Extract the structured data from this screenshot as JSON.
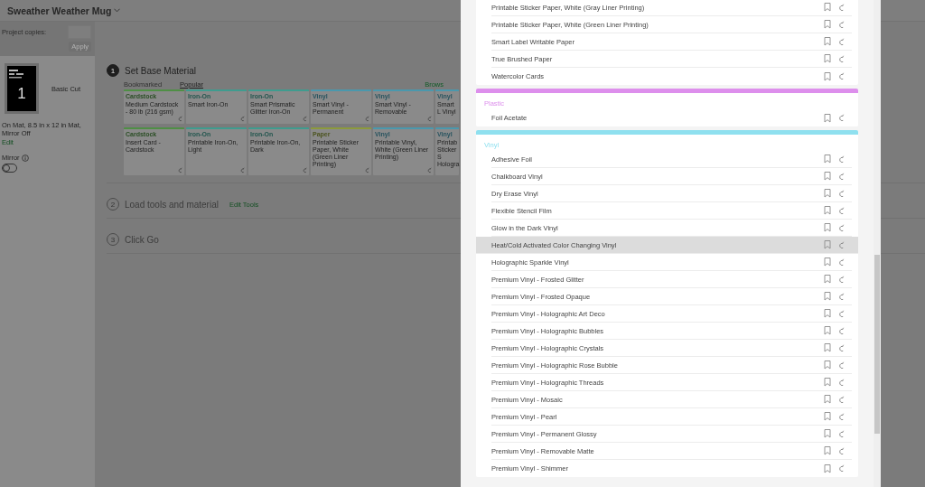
{
  "header": {
    "title": "Sweather Weather Mug"
  },
  "project_copies": {
    "label": "Project copies:",
    "apply": "Apply",
    "apply_disabled": true
  },
  "mat": {
    "number": "1",
    "name": "Basic Cut",
    "details": "On Mat, 8.5 in x 12 in Mat, Mirror Off",
    "edit": "Edit"
  },
  "mirror": {
    "label": "Mirror",
    "on": false
  },
  "steps": [
    {
      "number": "1",
      "title": "Set Base Material",
      "active": true
    },
    {
      "number": "2",
      "title": "Load tools and material",
      "link": "Edit Tools",
      "active": false
    },
    {
      "number": "3",
      "title": "Click Go",
      "active": false
    }
  ],
  "material_tabs": [
    {
      "label": "Bookmarked",
      "selected": false
    },
    {
      "label": "Popular",
      "selected": true
    }
  ],
  "browse_link": "Brows",
  "material_cards": [
    {
      "category": "Cardstock",
      "color": "#4f8f45",
      "name": "Medium Cardstock - 80 lb (216 gsm)"
    },
    {
      "category": "Iron-On",
      "color": "#3f9c8f",
      "name": "Smart Iron-On"
    },
    {
      "category": "Iron-On",
      "color": "#3f9c8f",
      "name": "Smart Prismatic Glitter Iron-On"
    },
    {
      "category": "Vinyl",
      "color": "#4a98ad",
      "name": "Smart Vinyl - Permanent"
    },
    {
      "category": "Vinyl",
      "color": "#4a98ad",
      "name": "Smart Vinyl - Removable"
    },
    {
      "category": "Vinyl",
      "color": "#4a98ad",
      "name": "Smart L Vinyl",
      "cut": true
    },
    {
      "category": "Cardstock",
      "color": "#4f8f45",
      "name": "Insert Card - Cardstock"
    },
    {
      "category": "Iron-On",
      "color": "#3f9c8f",
      "name": "Printable Iron-On, Light"
    },
    {
      "category": "Iron-On",
      "color": "#3f9c8f",
      "name": "Printable Iron-On, Dark"
    },
    {
      "category": "Paper",
      "color": "#8c9a3c",
      "name": "Printable Sticker Paper, White (Green Liner Printing)"
    },
    {
      "category": "Vinyl",
      "color": "#4a98ad",
      "name": "Printable Vinyl, White (Green Liner Printing)"
    },
    {
      "category": "Vinyl",
      "color": "#4a98ad",
      "name": "Printab Sticker S Hologra",
      "cut": true
    }
  ],
  "modal": {
    "sections": [
      {
        "items": [
          {
            "name": "Printable Sticker Paper, White (Gray Liner Printing)",
            "selected": false
          },
          {
            "name": "Printable Sticker Paper, White (Green Liner Printing)",
            "selected": false
          },
          {
            "name": "Smart Label Writable Paper",
            "selected": false
          },
          {
            "name": "True Brushed Paper",
            "selected": false
          },
          {
            "name": "Watercolor Cards",
            "selected": false
          }
        ]
      },
      {
        "name": "Plastic",
        "color": "#dd8fec",
        "items": [
          {
            "name": "Foil Acetate",
            "selected": false
          }
        ]
      },
      {
        "name": "Vinyl",
        "color": "#8fe0ef",
        "items": [
          {
            "name": "Adhesive Foil",
            "selected": false
          },
          {
            "name": "Chalkboard Vinyl",
            "selected": false
          },
          {
            "name": "Dry Erase Vinyl",
            "selected": false
          },
          {
            "name": "Flexible Stencil Film",
            "selected": false
          },
          {
            "name": "Glow in the Dark Vinyl",
            "selected": false
          },
          {
            "name": "Heat/Cold Activated Color Changing Vinyl",
            "selected": true
          },
          {
            "name": "Holographic Sparkle Vinyl",
            "selected": false
          },
          {
            "name": "Premium Vinyl - Frosted Glitter",
            "selected": false
          },
          {
            "name": "Premium Vinyl - Frosted Opaque",
            "selected": false
          },
          {
            "name": "Premium Vinyl - Holographic Art Deco",
            "selected": false
          },
          {
            "name": "Premium Vinyl - Holographic Bubbles",
            "selected": false
          },
          {
            "name": "Premium Vinyl - Holographic Crystals",
            "selected": false
          },
          {
            "name": "Premium Vinyl - Holographic Rose Bubble",
            "selected": false
          },
          {
            "name": "Premium Vinyl - Holographic Threads",
            "selected": false
          },
          {
            "name": "Premium Vinyl - Mosaic",
            "selected": false
          },
          {
            "name": "Premium Vinyl - Pearl",
            "selected": false
          },
          {
            "name": "Premium Vinyl - Permanent Glossy",
            "selected": false
          },
          {
            "name": "Premium Vinyl - Removable Matte",
            "selected": false
          },
          {
            "name": "Premium Vinyl - Shimmer",
            "selected": false
          }
        ]
      }
    ]
  }
}
